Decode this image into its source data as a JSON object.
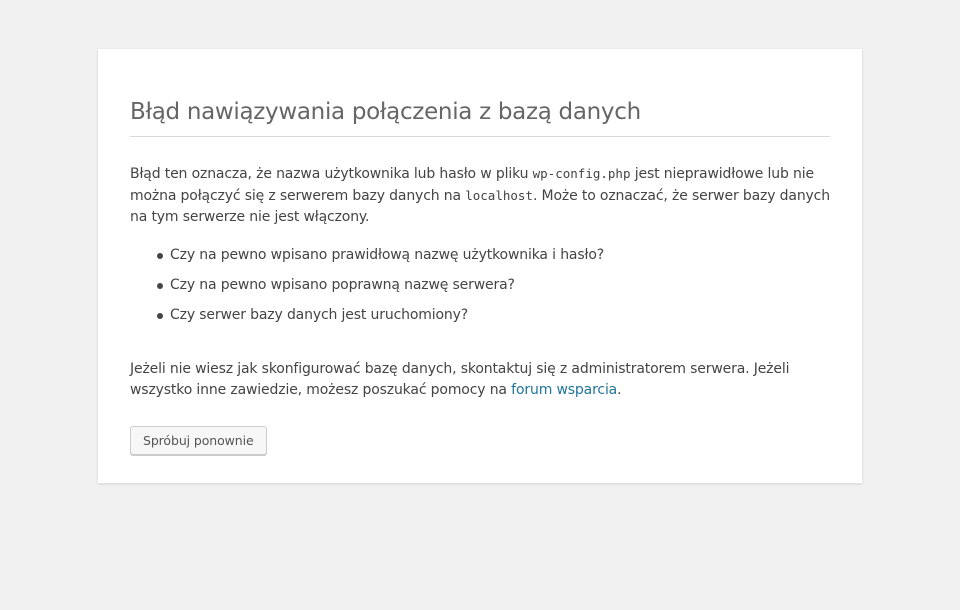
{
  "error": {
    "title": "Błąd nawiązywania połączenia z bazą danych",
    "intro": {
      "part1": "Błąd ten oznacza, że nazwa użytkownika lub hasło w pliku ",
      "config_file": "wp-config.php",
      "part2": " jest nieprawidłowe lub nie można połączyć się z serwerem bazy danych na ",
      "host": "localhost",
      "part3": ". Może to oznaczać, że serwer bazy danych na tym serwerze nie jest włączony."
    },
    "checklist": [
      "Czy na pewno wpisano prawidłową nazwę użytkownika i hasło?",
      "Czy na pewno wpisano poprawną nazwę serwera?",
      "Czy serwer bazy danych jest uruchomiony?"
    ],
    "help": {
      "part1": "Jeżeli nie wiesz jak skonfigurować bazę danych, skontaktuj się z administratorem serwera. Jeżeli wszystko inne zawiedzie, możesz poszukać pomocy na ",
      "link_text": "forum wsparcia",
      "part2": "."
    },
    "retry_button": "Spróbuj ponownie"
  },
  "colors": {
    "page_background": "#f1f1f1",
    "card_background": "#ffffff",
    "text": "#444444",
    "title": "#666666",
    "link": "#21759b"
  }
}
